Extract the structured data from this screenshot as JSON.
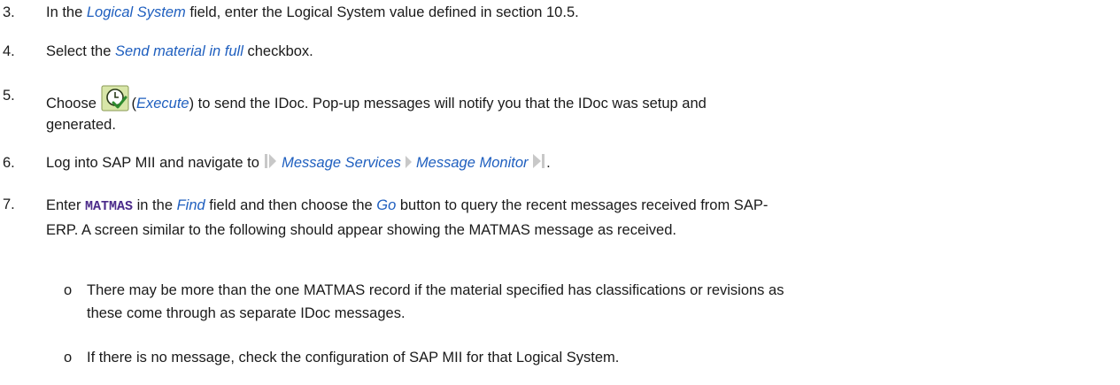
{
  "steps": [
    {
      "number": "3.",
      "before": "In the ",
      "field": "Logical System",
      "after": " field, enter the Logical System value defined in section 10.5."
    },
    {
      "number": "4.",
      "before": "Select the ",
      "field": "Send material in full",
      "after": " checkbox."
    },
    {
      "number": "5.",
      "before": "Choose ",
      "icon": "execute-icon",
      "paren_open": "(",
      "action": "Execute",
      "after_line1": ") to send the IDoc. Pop-up messages will notify you that the IDoc was setup and",
      "line2": "generated."
    },
    {
      "number": "6.",
      "before": "Log into SAP MII and navigate to ",
      "path": [
        "Message Services",
        "Message Monitor"
      ],
      "icons": [
        "path-start-icon",
        "path-separator-icon",
        "path-end-icon"
      ],
      "after": "."
    },
    {
      "number": "7.",
      "before": "Enter ",
      "code": "MATMAS",
      "mid1": " in the ",
      "field": "Find",
      "mid2": " field and then choose the ",
      "button": "Go",
      "after_line1": " button to query the recent messages received from SAP-",
      "line2": "ERP. A screen similar to the following should appear showing the MATMAS message as received."
    }
  ],
  "bullets": [
    {
      "marker": "o",
      "line1": "There may be more than the one MATMAS record if the material specified has classifications or revisions as",
      "line2": "these come through as separate IDoc messages."
    },
    {
      "marker": "o",
      "line1": "If there is no message, check the configuration of SAP MII for that Logical System."
    }
  ]
}
